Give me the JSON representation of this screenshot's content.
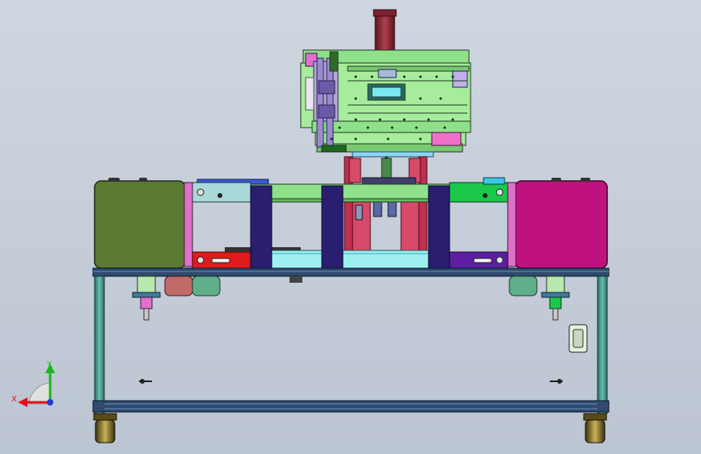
{
  "view": {
    "background_top": "#cfd6e0",
    "background_bottom": "#bcc5d2"
  },
  "triad": {
    "x_label": "X",
    "y_label": "Y",
    "x_color": "#e0141e",
    "y_color": "#16b81c",
    "z_color": "#1f3cd8"
  },
  "colors": {
    "frame": "#2f4a6e",
    "frame_light": "#5f8fb0",
    "leg_teal": "#3f9a8c",
    "left_cabinet": "#5a7a32",
    "right_cabinet": "#c0127e",
    "upper_plate": "#8fe08a",
    "column": "#9a2a3a",
    "post_navy": "#2a1e70",
    "red_block": "#e01b1b",
    "purple_block": "#5b1fa0",
    "green_block": "#1ac84a",
    "cyan_plate": "#9ef0f0",
    "slate_block": "#4a4a70",
    "motor": "#5fb08a",
    "motor_red": "#c06a6a",
    "caster": "#7a6a28"
  }
}
